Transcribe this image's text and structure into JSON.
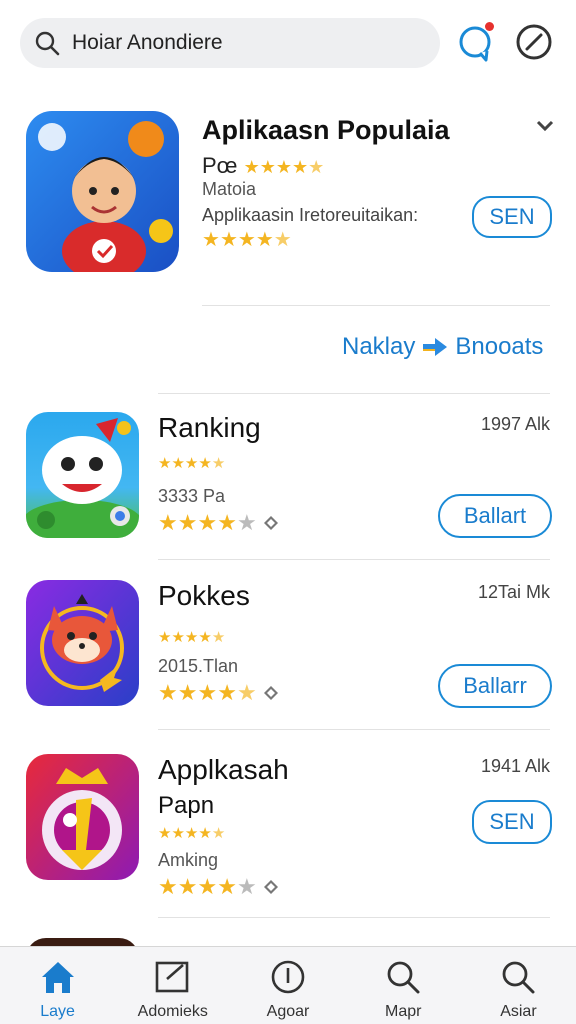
{
  "search": {
    "text": "Hoiar Anondiere"
  },
  "featured": {
    "title": "Aplikaasn Populaia",
    "subtitle": "Pœ",
    "category": "Matoia",
    "description": "Applikaasin Iretoreuitaikan:",
    "rating": 4.5,
    "button_label": "SEN"
  },
  "links": {
    "left": "Naklay",
    "right": "Bnooats"
  },
  "apps": [
    {
      "title": "Ranking",
      "subtitle": "",
      "meta": "3333 Pa",
      "size": "1997 Alk",
      "rating": 4,
      "small_rating": 4.5,
      "button_label": "Ballart",
      "accent": "#2aa4e8"
    },
    {
      "title": "Pokkes",
      "subtitle": "",
      "meta": "2015.Tlan",
      "size": "12Tai Mk",
      "rating": 4.5,
      "small_rating": 4.5,
      "button_label": "Ballarr",
      "accent": "#6a2fd0"
    },
    {
      "title": "Applkasah",
      "subtitle": "Papn",
      "meta": "Amking",
      "size": "1941 Alk",
      "rating": 4,
      "small_rating": 4.5,
      "button_label": "SEN",
      "accent": "#c8196a"
    }
  ],
  "tabs": [
    {
      "label": "Laye",
      "icon": "home-icon",
      "active": true
    },
    {
      "label": "Adomieks",
      "icon": "edit-square-icon",
      "active": false
    },
    {
      "label": "Agoar",
      "icon": "info-circle-icon",
      "active": false
    },
    {
      "label": "Mapr",
      "icon": "search-icon",
      "active": false
    },
    {
      "label": "Asiar",
      "icon": "search-icon",
      "active": false
    }
  ],
  "colors": {
    "accent": "#1a7ccc",
    "star": "#f4b521",
    "notification": "#e6312e"
  }
}
